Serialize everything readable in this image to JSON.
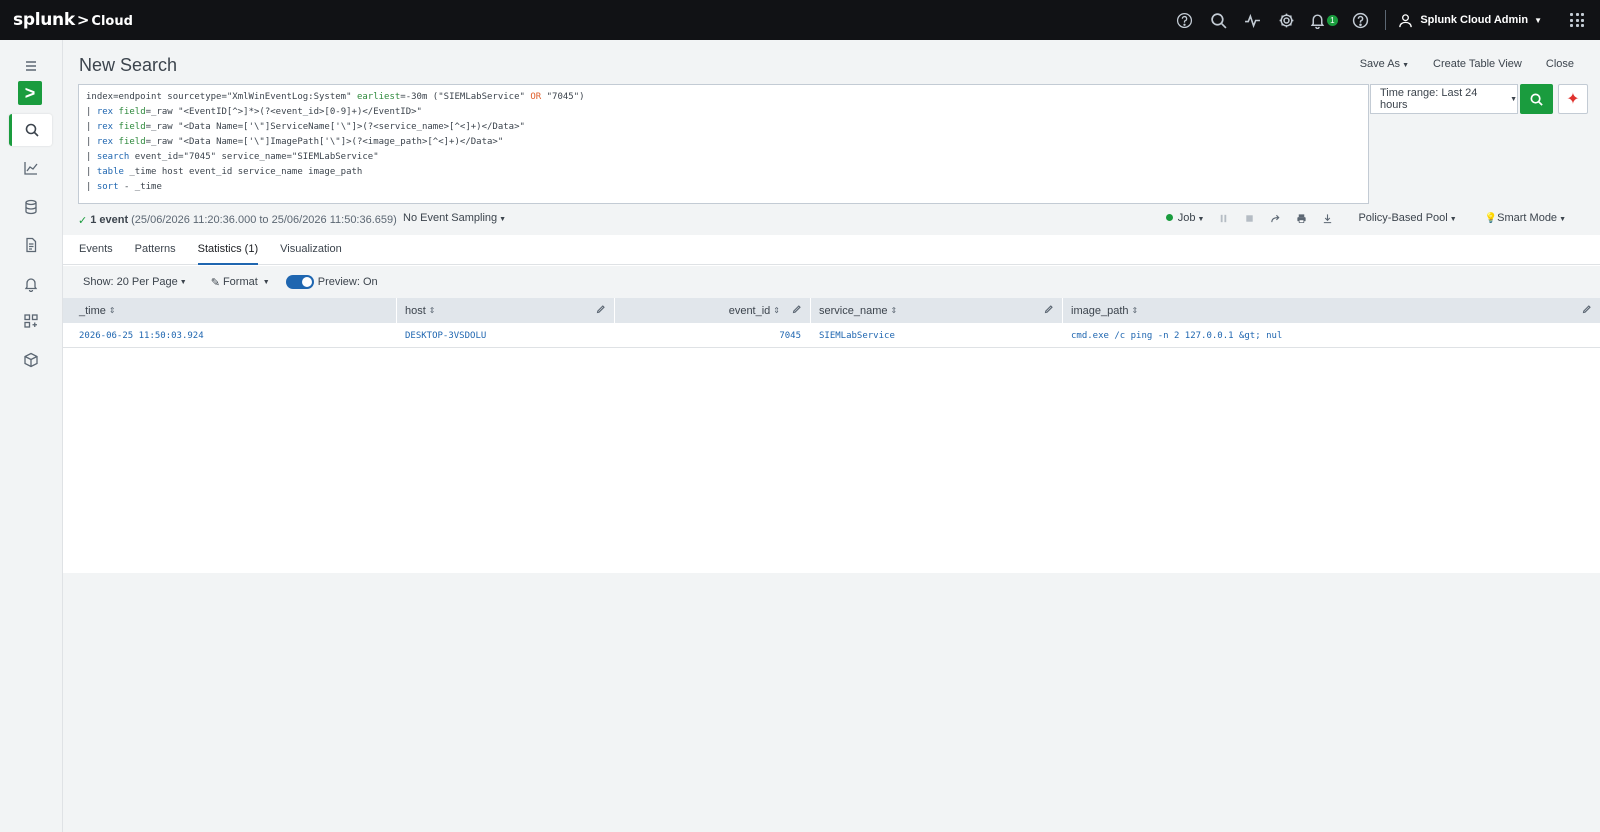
{
  "topbar": {
    "brand": "splunk",
    "brand_suffix": "Cloud",
    "notification_count": "1",
    "user_name": "Splunk Cloud Admin"
  },
  "page": {
    "title": "New Search",
    "actions": {
      "save_as": "Save As",
      "create_table_view": "Create Table View",
      "close": "Close"
    }
  },
  "search": {
    "query_lines": [
      "index=endpoint sourcetype=\"XmlWinEventLog:System\" earliest=-30m (\"SIEMLabService\" OR \"7045\")",
      "| rex field=_raw \"<EventID[^>]*>(?<event_id>[0-9]+)</EventID>\"",
      "| rex field=_raw \"<Data Name=['\\\"]ServiceName['\\\"]>(?<service_name>[^<]+)</Data>\"",
      "| rex field=_raw \"<Data Name=['\\\"]ImagePath['\\\"]>(?<image_path>[^<]+)</Data>\"",
      "| search event_id=\"7045\" service_name=\"SIEMLabService\"",
      "| table _time host event_id service_name image_path",
      "| sort - _time"
    ],
    "time_range": "Time range: Last 24 hours"
  },
  "status": {
    "event_count": "1 event",
    "event_range": "(25/06/2026 11:20:36.000 to 25/06/2026 11:50:36.659)",
    "sampling": "No Event Sampling",
    "job": "Job",
    "pool": "Policy-Based Pool",
    "mode": "Smart Mode"
  },
  "tabs": [
    {
      "label": "Events"
    },
    {
      "label": "Patterns"
    },
    {
      "label": "Statistics (1)"
    },
    {
      "label": "Visualization"
    }
  ],
  "table_toolbar": {
    "show": "Show: 20 Per Page",
    "format": "Format",
    "preview": "Preview: On"
  },
  "table": {
    "columns": [
      "_time",
      "host",
      "event_id",
      "service_name",
      "image_path"
    ],
    "rows": [
      [
        "2026-06-25 11:50:03.924",
        "DESKTOP-3VSDOLU",
        "7045",
        "SIEMLabService",
        "cmd.exe /c ping -n 2 127.0.0.1 &gt; nul"
      ]
    ]
  },
  "colors": {
    "accent_green": "#1a9c3e",
    "link_blue": "#1f66b0",
    "topbar_bg": "#111215"
  }
}
